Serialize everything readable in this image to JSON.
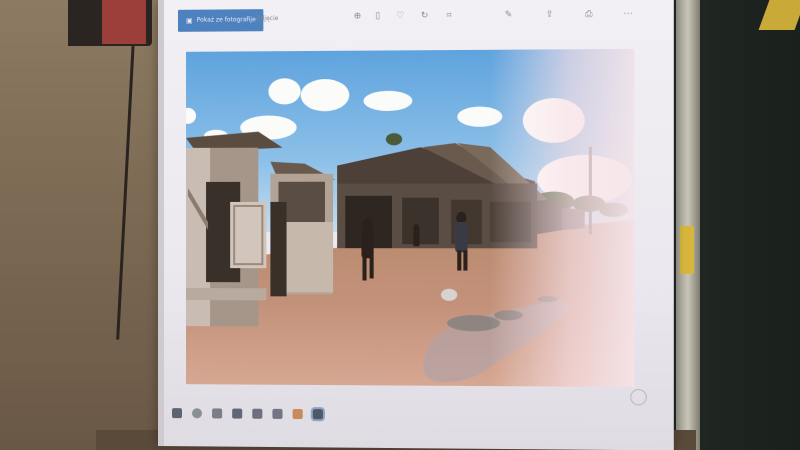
{
  "screen": {
    "app_bar": {
      "open_button_label": "Pokaż ze fotografije",
      "tab_label": "Zdjęcie"
    },
    "toolbar_icons": [
      "zoom-icon",
      "delete-icon",
      "favorite-icon",
      "rotate-icon",
      "crop-icon",
      "edit-icon",
      "share-icon",
      "print-icon",
      "more-icon"
    ],
    "photo": {
      "subject": "unpaved street with wooden market stalls and walking people"
    },
    "taskbar_icons": [
      "windows-start-icon",
      "search-icon",
      "task-view-icon",
      "file-explorer-icon",
      "store-icon",
      "mail-icon",
      "app-icon",
      "photos-icon"
    ]
  },
  "colors": {
    "accent": "#4e82bf",
    "sky": "#6aaae0",
    "ground": "#c28f74"
  }
}
